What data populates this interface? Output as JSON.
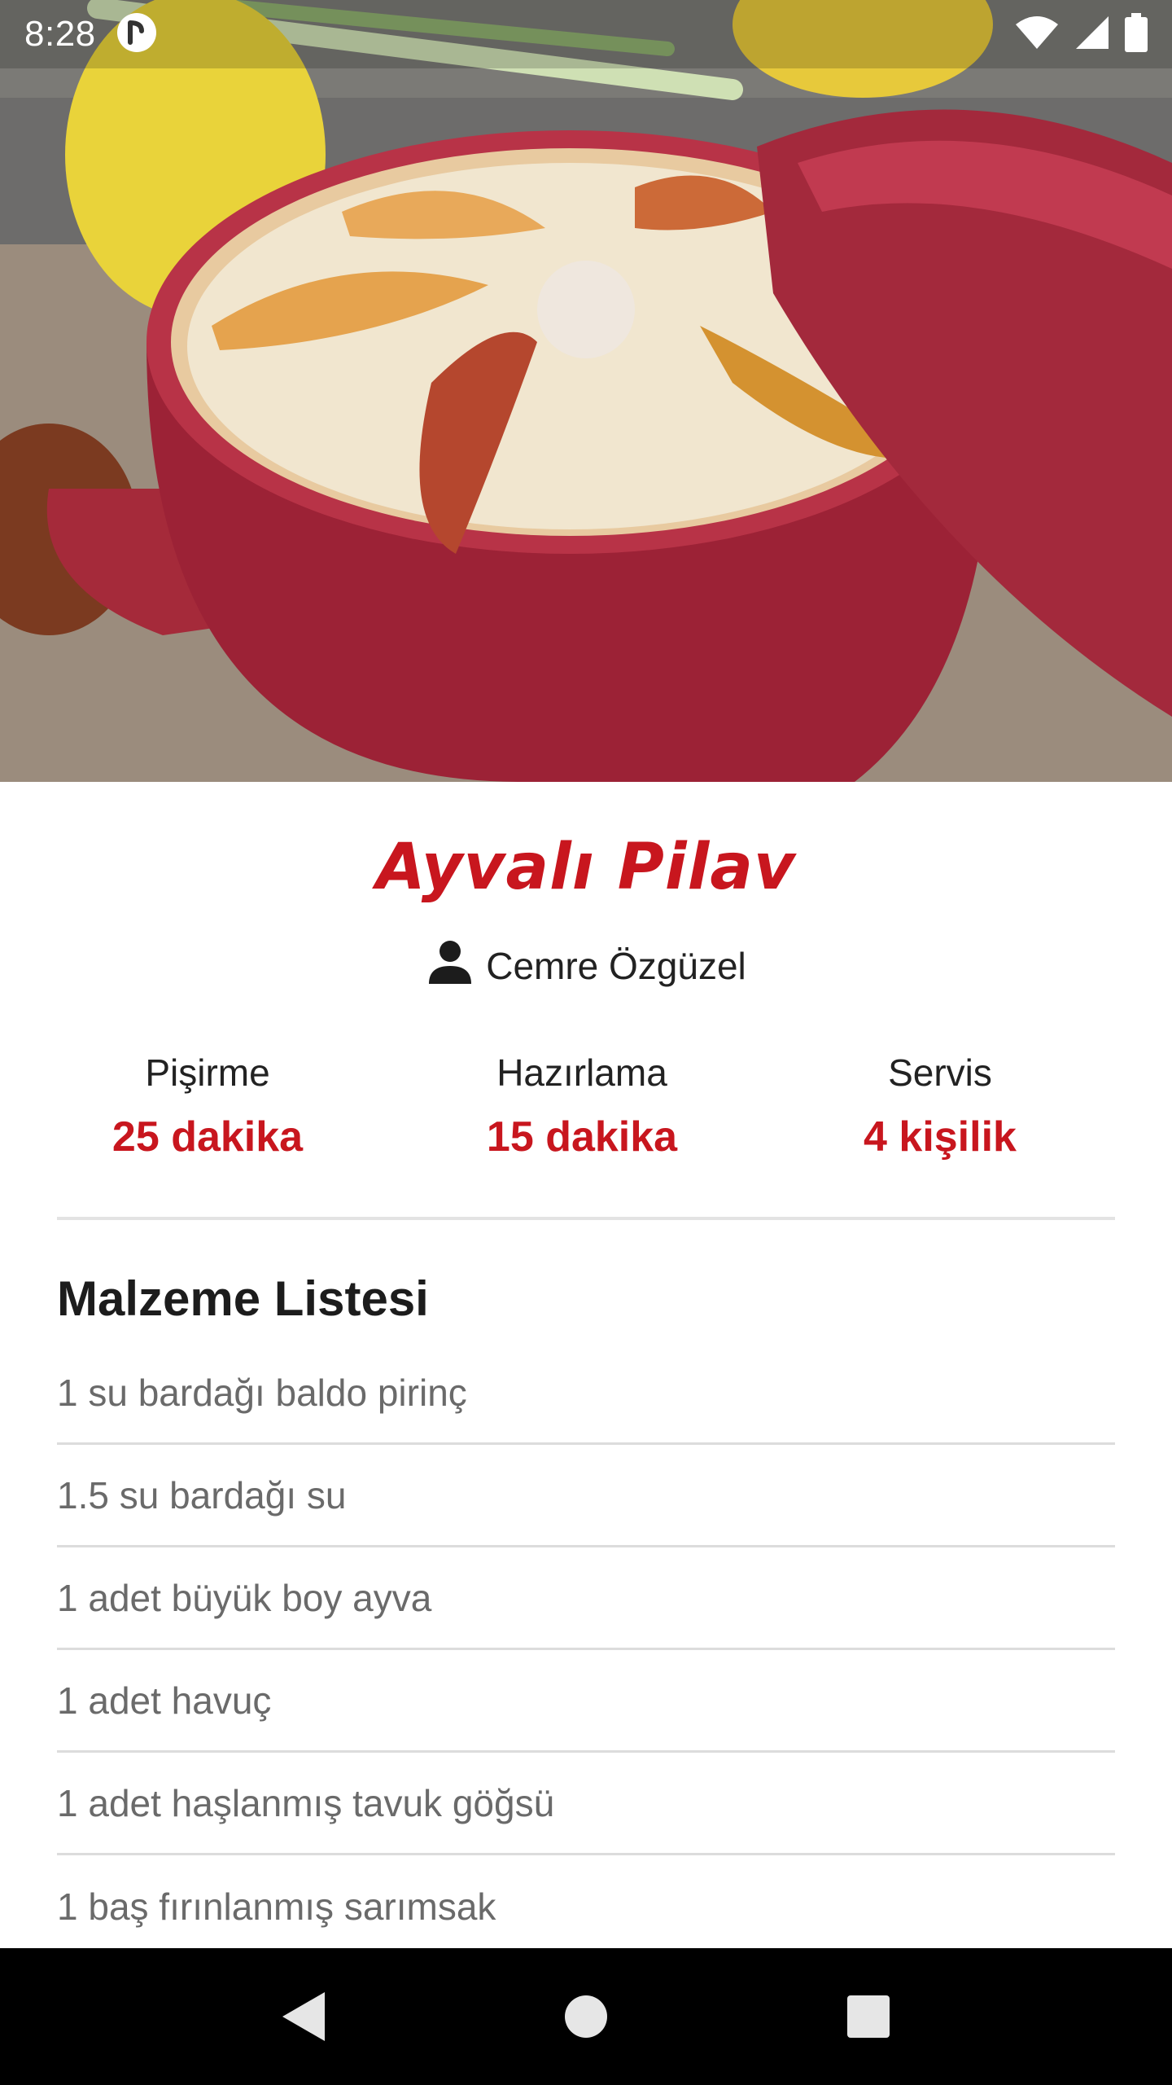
{
  "status_bar": {
    "time": "8:28",
    "icons": [
      "app-notification-icon",
      "wifi-icon",
      "cellular-signal-icon",
      "battery-icon"
    ]
  },
  "hero_image": {
    "description_icon": "recipe-photo"
  },
  "recipe": {
    "title": "Ayvalı Pilav",
    "author": "Cemre Özgüzel",
    "stats": [
      {
        "label": "Pişirme",
        "value": "25 dakika"
      },
      {
        "label": "Hazırlama",
        "value": "15 dakika"
      },
      {
        "label": "Servis",
        "value": "4 kişilik"
      }
    ],
    "ingredients_title": "Malzeme Listesi",
    "ingredients": [
      "1 su bardağı baldo pirinç",
      "1.5 su bardağı su",
      "1 adet büyük boy ayva",
      "1 adet havuç",
      "1 adet haşlanmış tavuk göğsü",
      "1 baş fırınlanmış sarımsak"
    ]
  },
  "nav_bar": {
    "icons": [
      "back-icon",
      "home-icon",
      "recents-icon"
    ]
  },
  "colors": {
    "accent": "#c8161e",
    "text_dark": "#222222",
    "text_muted": "#6a6a6a",
    "divider": "#e3e3e3"
  }
}
